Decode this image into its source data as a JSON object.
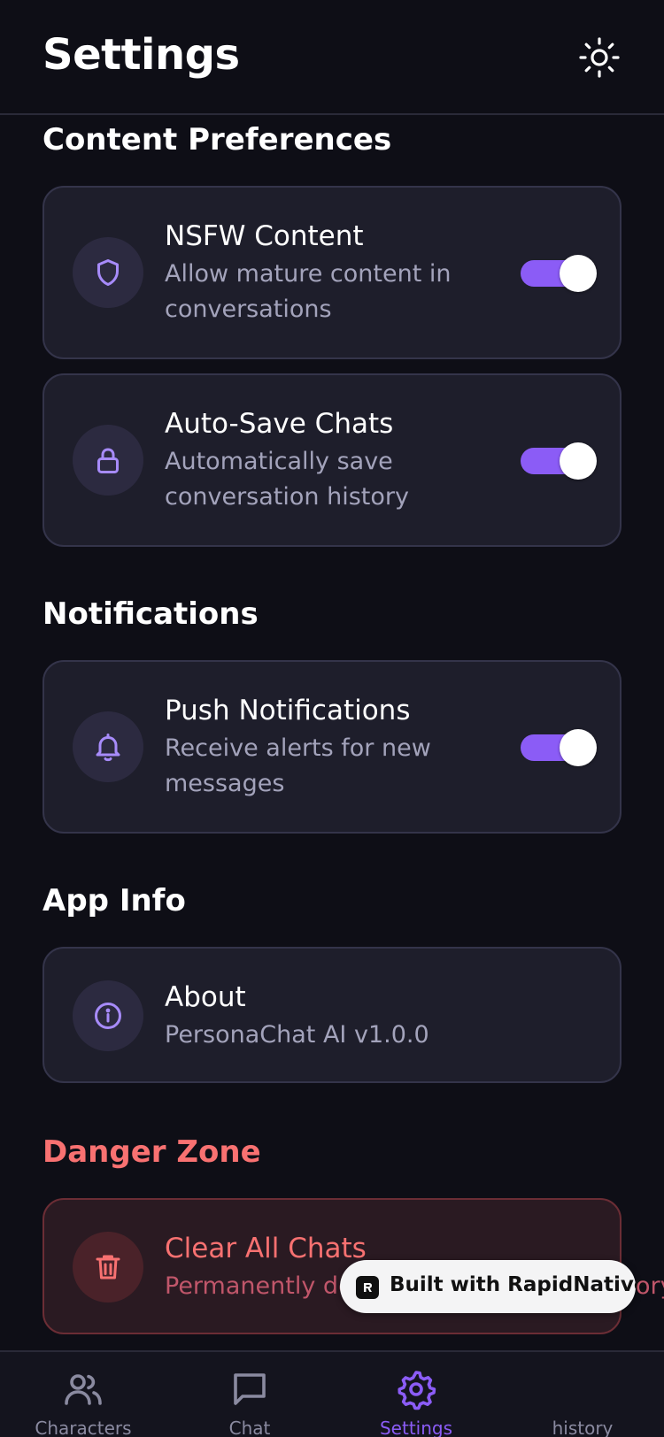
{
  "header": {
    "title": "Settings",
    "theme_icon": "sun-icon"
  },
  "sections": {
    "content_preferences": {
      "title": "Content Preferences",
      "items": [
        {
          "title": "NSFW Content",
          "subtitle": "Allow mature content in conversations",
          "icon": "shield-icon",
          "enabled": true
        },
        {
          "title": "Auto-Save Chats",
          "subtitle": "Automatically save conversation history",
          "icon": "lock-icon",
          "enabled": true
        }
      ]
    },
    "notifications": {
      "title": "Notifications",
      "items": [
        {
          "title": "Push Notifications",
          "subtitle": "Receive alerts for new messages",
          "icon": "bell-icon",
          "enabled": true
        }
      ]
    },
    "app_info": {
      "title": "App Info",
      "items": [
        {
          "title": "About",
          "subtitle": "PersonaChat AI v1.0.0",
          "icon": "info-icon"
        }
      ]
    },
    "danger_zone": {
      "title": "Danger Zone",
      "items": [
        {
          "title": "Clear All Chats",
          "subtitle_visible_start": "Permanently de",
          "subtitle_visible_end": "ory",
          "icon": "trash-icon"
        }
      ]
    }
  },
  "badge": {
    "text": "Built with RapidNative"
  },
  "tabbar": {
    "tabs": [
      {
        "label": "Characters",
        "icon": "users-icon",
        "active": false
      },
      {
        "label": "Chat",
        "icon": "chat-bubble-icon",
        "active": false
      },
      {
        "label": "Settings",
        "icon": "gear-icon",
        "active": true
      },
      {
        "label": "history",
        "icon": "",
        "active": false
      }
    ]
  },
  "colors": {
    "background": "#0e0e16",
    "card": "#1e1e2b",
    "accent": "#8b5cf6",
    "danger": "#f87171"
  }
}
